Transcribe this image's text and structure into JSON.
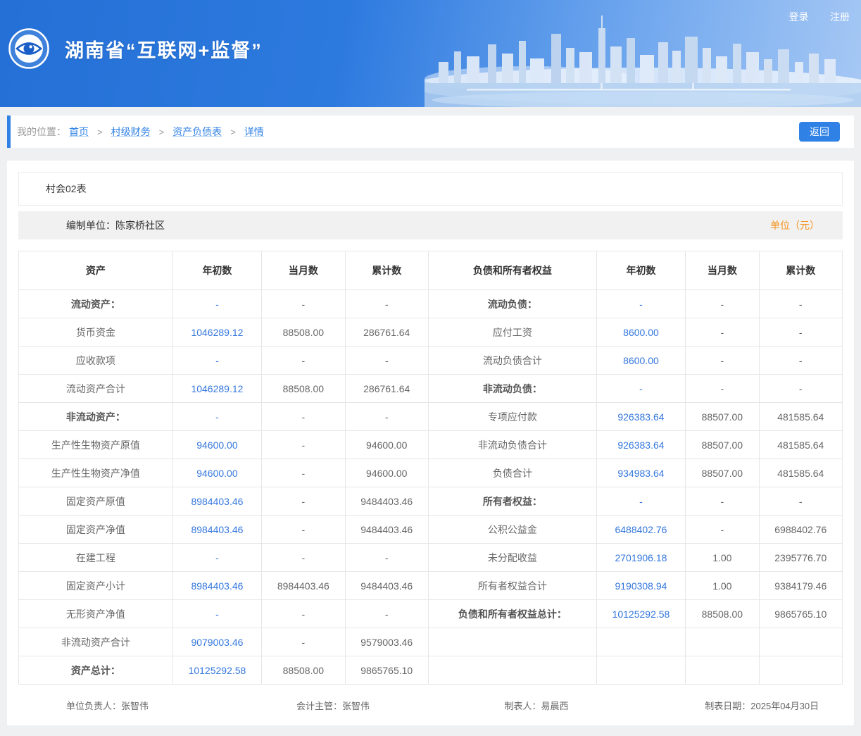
{
  "header": {
    "title": "湖南省“互联网+监督”",
    "login": "登录",
    "register": "注册"
  },
  "breadcrumb": {
    "label": "我的位置：",
    "items": [
      "首页",
      "村级财务",
      "资产负债表",
      "详情"
    ],
    "separator": ">",
    "back_button": "返回"
  },
  "colors": {
    "banner_blue": "#2d7adf",
    "accent_blue": "#2f81e6",
    "link_blue": "#3477dd",
    "orange": "#f7941d"
  },
  "report": {
    "title": "村会02表",
    "unit_label": "编制单位：陈家桥社区",
    "currency_label": "单位（元）",
    "table": {
      "headers": [
        "资产",
        "年初数",
        "当月数",
        "累计数",
        "负债和所有者权益",
        "年初数",
        "当月数",
        "累计数"
      ],
      "rows": [
        [
          {
            "text": "流动资产：",
            "bold": true
          },
          {
            "text": "-",
            "link": true
          },
          {
            "text": "-"
          },
          {
            "text": "-"
          },
          {
            "text": "流动负债：",
            "bold": true
          },
          {
            "text": "-",
            "link": true
          },
          {
            "text": "-"
          },
          {
            "text": "-"
          }
        ],
        [
          {
            "text": "货币资金"
          },
          {
            "text": "1046289.12",
            "link": true
          },
          {
            "text": "88508.00"
          },
          {
            "text": "286761.64"
          },
          {
            "text": "应付工资"
          },
          {
            "text": "8600.00",
            "link": true
          },
          {
            "text": "-"
          },
          {
            "text": "-"
          }
        ],
        [
          {
            "text": "应收款项"
          },
          {
            "text": "-",
            "link": true
          },
          {
            "text": "-"
          },
          {
            "text": "-"
          },
          {
            "text": "流动负债合计"
          },
          {
            "text": "8600.00",
            "link": true
          },
          {
            "text": "-"
          },
          {
            "text": "-"
          }
        ],
        [
          {
            "text": "流动资产合计"
          },
          {
            "text": "1046289.12",
            "link": true
          },
          {
            "text": "88508.00"
          },
          {
            "text": "286761.64"
          },
          {
            "text": "非流动负债：",
            "bold": true
          },
          {
            "text": "-",
            "link": true
          },
          {
            "text": "-"
          },
          {
            "text": "-"
          }
        ],
        [
          {
            "text": "非流动资产：",
            "bold": true
          },
          {
            "text": "-",
            "link": true
          },
          {
            "text": "-"
          },
          {
            "text": "-"
          },
          {
            "text": "专项应付款"
          },
          {
            "text": "926383.64",
            "link": true
          },
          {
            "text": "88507.00"
          },
          {
            "text": "481585.64"
          }
        ],
        [
          {
            "text": "生产性生物资产原值"
          },
          {
            "text": "94600.00",
            "link": true
          },
          {
            "text": "-"
          },
          {
            "text": "94600.00"
          },
          {
            "text": "非流动负债合计"
          },
          {
            "text": "926383.64",
            "link": true
          },
          {
            "text": "88507.00"
          },
          {
            "text": "481585.64"
          }
        ],
        [
          {
            "text": "生产性生物资产净值"
          },
          {
            "text": "94600.00",
            "link": true
          },
          {
            "text": "-"
          },
          {
            "text": "94600.00"
          },
          {
            "text": "负债合计"
          },
          {
            "text": "934983.64",
            "link": true
          },
          {
            "text": "88507.00"
          },
          {
            "text": "481585.64"
          }
        ],
        [
          {
            "text": "固定资产原值"
          },
          {
            "text": "8984403.46",
            "link": true
          },
          {
            "text": "-"
          },
          {
            "text": "9484403.46"
          },
          {
            "text": "所有者权益：",
            "bold": true
          },
          {
            "text": "-",
            "link": true
          },
          {
            "text": "-"
          },
          {
            "text": "-"
          }
        ],
        [
          {
            "text": "固定资产净值"
          },
          {
            "text": "8984403.46",
            "link": true
          },
          {
            "text": "-"
          },
          {
            "text": "9484403.46"
          },
          {
            "text": "公积公益金"
          },
          {
            "text": "6488402.76",
            "link": true
          },
          {
            "text": "-"
          },
          {
            "text": "6988402.76"
          }
        ],
        [
          {
            "text": "在建工程"
          },
          {
            "text": "-",
            "link": true
          },
          {
            "text": "-"
          },
          {
            "text": "-"
          },
          {
            "text": "未分配收益"
          },
          {
            "text": "2701906.18",
            "link": true
          },
          {
            "text": "1.00"
          },
          {
            "text": "2395776.70"
          }
        ],
        [
          {
            "text": "固定资产小计"
          },
          {
            "text": "8984403.46",
            "link": true
          },
          {
            "text": "8984403.46"
          },
          {
            "text": "9484403.46"
          },
          {
            "text": "所有者权益合计"
          },
          {
            "text": "9190308.94",
            "link": true
          },
          {
            "text": "1.00"
          },
          {
            "text": "9384179.46"
          }
        ],
        [
          {
            "text": "无形资产净值"
          },
          {
            "text": "-",
            "link": true
          },
          {
            "text": "-"
          },
          {
            "text": "-"
          },
          {
            "text": "负债和所有者权益总计：",
            "bold": true
          },
          {
            "text": "10125292.58",
            "link": true
          },
          {
            "text": "88508.00"
          },
          {
            "text": "9865765.10"
          }
        ],
        [
          {
            "text": "非流动资产合计"
          },
          {
            "text": "9079003.46",
            "link": true
          },
          {
            "text": "-"
          },
          {
            "text": "9579003.46"
          },
          {
            "text": ""
          },
          {
            "text": ""
          },
          {
            "text": ""
          },
          {
            "text": ""
          }
        ],
        [
          {
            "text": "资产总计：",
            "bold": true
          },
          {
            "text": "10125292.58",
            "link": true
          },
          {
            "text": "88508.00"
          },
          {
            "text": "9865765.10"
          },
          {
            "text": ""
          },
          {
            "text": ""
          },
          {
            "text": ""
          },
          {
            "text": ""
          }
        ]
      ]
    },
    "signatures": [
      "单位负责人：张智伟",
      "会计主管：张智伟",
      "制表人：易晨西",
      "制表日期：2025年04月30日"
    ]
  }
}
